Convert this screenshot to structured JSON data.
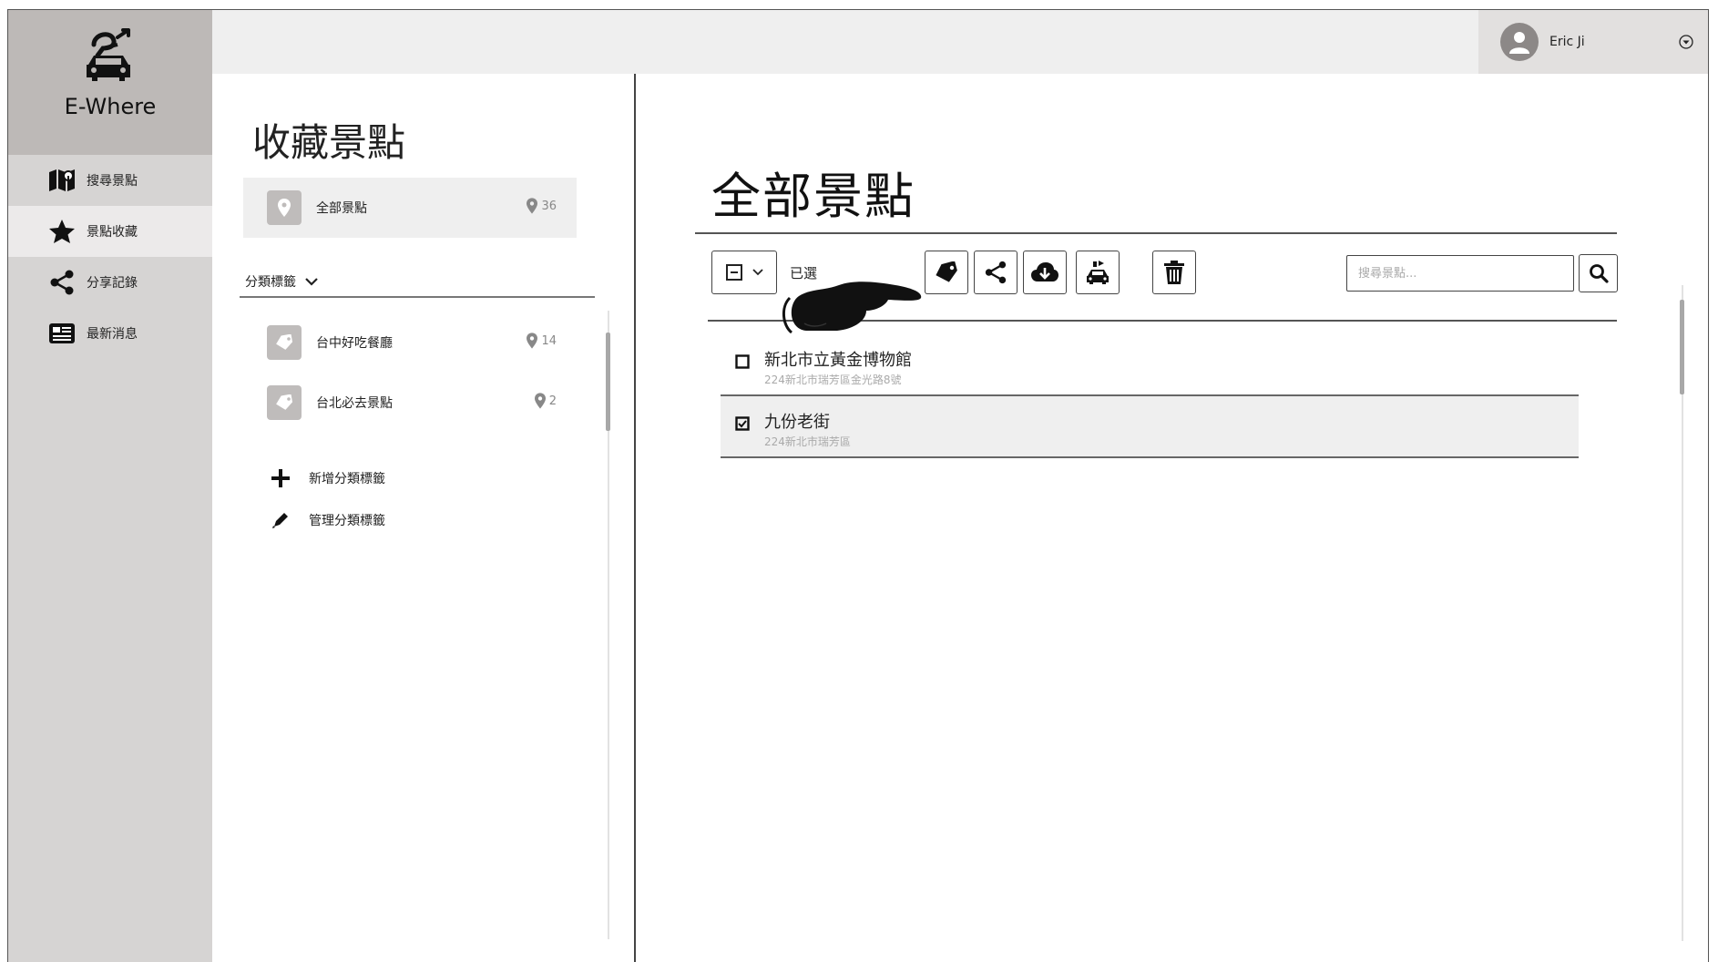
{
  "app": {
    "name": "E-Where"
  },
  "sidebar": {
    "items": [
      {
        "label": "搜尋景點",
        "icon": "map-icon",
        "active": false
      },
      {
        "label": "景點收藏",
        "icon": "star-icon",
        "active": true
      },
      {
        "label": "分享記錄",
        "icon": "share-icon",
        "active": false
      },
      {
        "label": "最新消息",
        "icon": "newspaper-icon",
        "active": false
      }
    ]
  },
  "user": {
    "name": "Eric Ji",
    "icon": "user-icon",
    "menu_icon": "caret-down-circle-icon"
  },
  "collections": {
    "title": "收藏景點",
    "all": {
      "label": "全部景點",
      "count": "36"
    },
    "category_header": "分類標籤",
    "categories": [
      {
        "label": "台中好吃餐廳",
        "count": "14"
      },
      {
        "label": "台北必去景點",
        "count": "2"
      }
    ],
    "add_label": "新增分類標籤",
    "manage_label": "管理分類標籤"
  },
  "main": {
    "title": "全部景點",
    "selected_text": "已選",
    "toolbar_icons": [
      "tag-icon",
      "share-icon",
      "cloud-download-icon",
      "car-icon",
      "trash-icon"
    ],
    "search": {
      "placeholder": "搜尋景點..."
    },
    "attractions": [
      {
        "name": "新北市立黃金博物館",
        "address": "224新北市瑞芳區金光路8號",
        "checked": false
      },
      {
        "name": "九份老街",
        "address": "224新北市瑞芳區",
        "checked": true
      }
    ]
  },
  "colors": {
    "sidebar_bg": "#d6d4d3",
    "logo_bg": "#bdb9b7",
    "active_nav": "#eceaea",
    "topbar_bg": "#efefef",
    "row_highlight": "#efefef"
  }
}
